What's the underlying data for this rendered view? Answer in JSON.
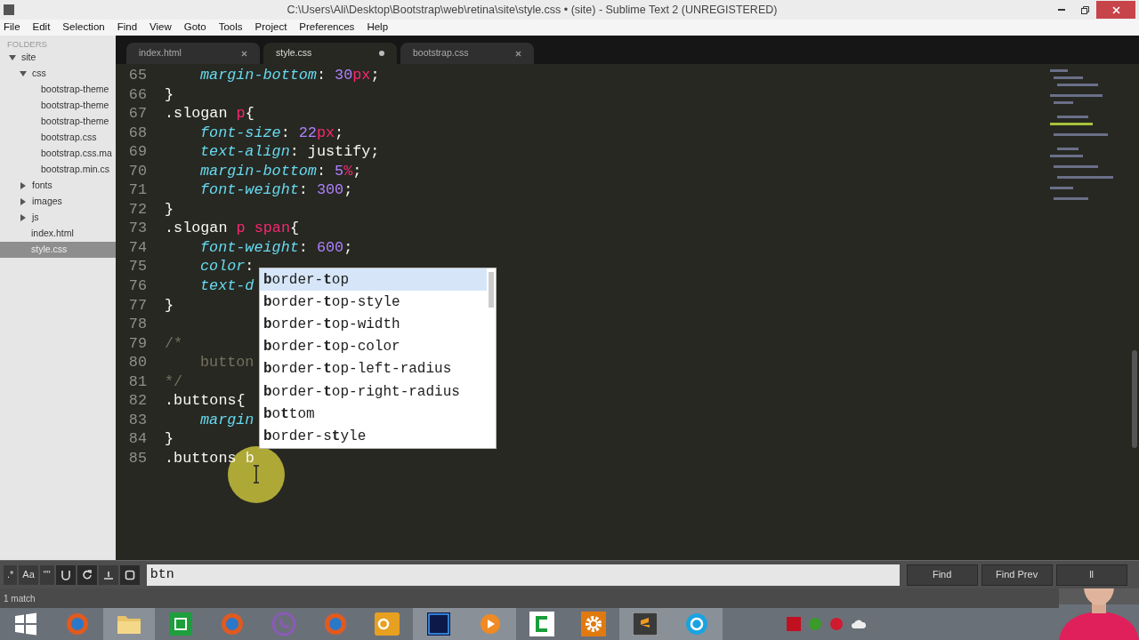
{
  "window": {
    "title": "C:\\Users\\Ali\\Desktop\\Bootstrap\\web\\retina\\site\\style.css • (site) - Sublime Text 2 (UNREGISTERED)"
  },
  "menu": [
    "File",
    "Edit",
    "Selection",
    "Find",
    "View",
    "Goto",
    "Tools",
    "Project",
    "Preferences",
    "Help"
  ],
  "sidebar": {
    "heading": "FOLDERS",
    "items": [
      {
        "label": "site",
        "kind": "folder",
        "expanded": true,
        "selected": false,
        "children": [
          {
            "label": "css",
            "kind": "folder",
            "expanded": true,
            "selected": false,
            "children": [
              {
                "label": "bootstrap-theme",
                "kind": "file",
                "selected": false
              },
              {
                "label": "bootstrap-theme",
                "kind": "file",
                "selected": false
              },
              {
                "label": "bootstrap-theme",
                "kind": "file",
                "selected": false
              },
              {
                "label": "bootstrap.css",
                "kind": "file",
                "selected": false
              },
              {
                "label": "bootstrap.css.ma",
                "kind": "file",
                "selected": false
              },
              {
                "label": "bootstrap.min.cs",
                "kind": "file",
                "selected": false
              }
            ]
          },
          {
            "label": "fonts",
            "kind": "folder",
            "expanded": false,
            "selected": false
          },
          {
            "label": "images",
            "kind": "folder",
            "expanded": false,
            "selected": false
          },
          {
            "label": "js",
            "kind": "folder",
            "expanded": false,
            "selected": false
          },
          {
            "label": "index.html",
            "kind": "file",
            "selected": false
          },
          {
            "label": "style.css",
            "kind": "file",
            "selected": true
          }
        ]
      }
    ]
  },
  "tabs": [
    {
      "label": "index.html",
      "selected": false,
      "modified": false
    },
    {
      "label": "style.css",
      "selected": true,
      "modified": true
    },
    {
      "label": "bootstrap.css",
      "selected": false,
      "modified": false
    }
  ],
  "code": [
    {
      "n": "65",
      "indent": true,
      "tokens": [
        {
          "t": "margin-bottom",
          "kind": "prop"
        },
        {
          "t": ": ",
          "kind": "plain"
        },
        {
          "t": "30",
          "kind": "num"
        },
        {
          "t": "px",
          "kind": "unit"
        },
        {
          "t": ";",
          "kind": "plain"
        }
      ]
    },
    {
      "n": "66",
      "indent": false,
      "tokens": [
        {
          "t": "}",
          "kind": "plain"
        }
      ]
    },
    {
      "n": "67",
      "indent": false,
      "tokens": [
        {
          "t": ".slogan ",
          "kind": "plain"
        },
        {
          "t": "p",
          "kind": "tag"
        },
        {
          "t": "{",
          "kind": "plain"
        }
      ]
    },
    {
      "n": "68",
      "indent": true,
      "tokens": [
        {
          "t": "font-size",
          "kind": "prop"
        },
        {
          "t": ": ",
          "kind": "plain"
        },
        {
          "t": "22",
          "kind": "num"
        },
        {
          "t": "px",
          "kind": "unit"
        },
        {
          "t": ";",
          "kind": "plain"
        }
      ]
    },
    {
      "n": "69",
      "indent": true,
      "tokens": [
        {
          "t": "text-align",
          "kind": "prop"
        },
        {
          "t": ": justify;",
          "kind": "plain"
        }
      ]
    },
    {
      "n": "70",
      "indent": true,
      "tokens": [
        {
          "t": "margin-bottom",
          "kind": "prop"
        },
        {
          "t": ": ",
          "kind": "plain"
        },
        {
          "t": "5",
          "kind": "num"
        },
        {
          "t": "%",
          "kind": "unit"
        },
        {
          "t": ";",
          "kind": "plain"
        }
      ]
    },
    {
      "n": "71",
      "indent": true,
      "tokens": [
        {
          "t": "font-weight",
          "kind": "prop"
        },
        {
          "t": ": ",
          "kind": "plain"
        },
        {
          "t": "300",
          "kind": "num"
        },
        {
          "t": ";",
          "kind": "plain"
        }
      ]
    },
    {
      "n": "72",
      "indent": false,
      "tokens": [
        {
          "t": "}",
          "kind": "plain"
        }
      ]
    },
    {
      "n": "73",
      "indent": false,
      "tokens": [
        {
          "t": ".slogan ",
          "kind": "plain"
        },
        {
          "t": "p span",
          "kind": "tag"
        },
        {
          "t": "{",
          "kind": "plain"
        }
      ]
    },
    {
      "n": "74",
      "indent": true,
      "tokens": [
        {
          "t": "font-weight",
          "kind": "prop"
        },
        {
          "t": ": ",
          "kind": "plain"
        },
        {
          "t": "600",
          "kind": "num"
        },
        {
          "t": ";",
          "kind": "plain"
        }
      ]
    },
    {
      "n": "75",
      "indent": true,
      "tokens": [
        {
          "t": "color",
          "kind": "prop"
        },
        {
          "t": ":",
          "kind": "plain"
        }
      ]
    },
    {
      "n": "76",
      "indent": true,
      "tokens": [
        {
          "t": "text-d",
          "kind": "prop"
        }
      ]
    },
    {
      "n": "77",
      "indent": false,
      "tokens": [
        {
          "t": "}",
          "kind": "plain"
        }
      ]
    },
    {
      "n": "78"
    },
    {
      "n": "79",
      "indent": false,
      "tokens": [
        {
          "t": "/*",
          "kind": "comment"
        }
      ]
    },
    {
      "n": "80",
      "indent": true,
      "tokens": [
        {
          "t": "button",
          "kind": "comment"
        }
      ]
    },
    {
      "n": "81",
      "indent": false,
      "tokens": [
        {
          "t": "*/",
          "kind": "comment"
        }
      ]
    },
    {
      "n": "82",
      "indent": false,
      "tokens": [
        {
          "t": ".buttons{",
          "kind": "plain"
        }
      ]
    },
    {
      "n": "83",
      "indent": true,
      "tokens": [
        {
          "t": "margin",
          "kind": "prop"
        }
      ]
    },
    {
      "n": "84",
      "indent": false,
      "tokens": [
        {
          "t": "}",
          "kind": "plain"
        }
      ]
    },
    {
      "n": "85",
      "indent": false,
      "tokens": [
        {
          "t": ".buttons b",
          "kind": "plain"
        }
      ]
    }
  ],
  "autocomplete": [
    {
      "label": "**b**order-**t**op",
      "selected": true
    },
    {
      "label": "**b**order-**t**op-style",
      "selected": false
    },
    {
      "label": "**b**order-**t**op-width",
      "selected": false
    },
    {
      "label": "**b**order-**t**op-color",
      "selected": false
    },
    {
      "label": "**b**order-**t**op-left-radius",
      "selected": false
    },
    {
      "label": "**b**order-**t**op-right-radius",
      "selected": false
    },
    {
      "label": "**b**o**t**tom",
      "selected": false
    },
    {
      "label": "**b**order-s**t**yle",
      "selected": false
    }
  ],
  "find_panel": {
    "options": [
      {
        "label": ".*",
        "on": false
      },
      {
        "label": "Aa",
        "on": false
      },
      {
        "label": "\"\"",
        "on": false
      }
    ],
    "toggles": [
      {
        "kind": "wrap",
        "on": true
      },
      {
        "kind": "reverse",
        "on": true
      },
      {
        "kind": "highlight",
        "on": false
      },
      {
        "kind": "panel",
        "on": true
      }
    ],
    "query": "btn",
    "buttons": [
      "Find",
      "Find Prev",
      "ll"
    ]
  },
  "status_bar": {
    "text": "1 match"
  }
}
